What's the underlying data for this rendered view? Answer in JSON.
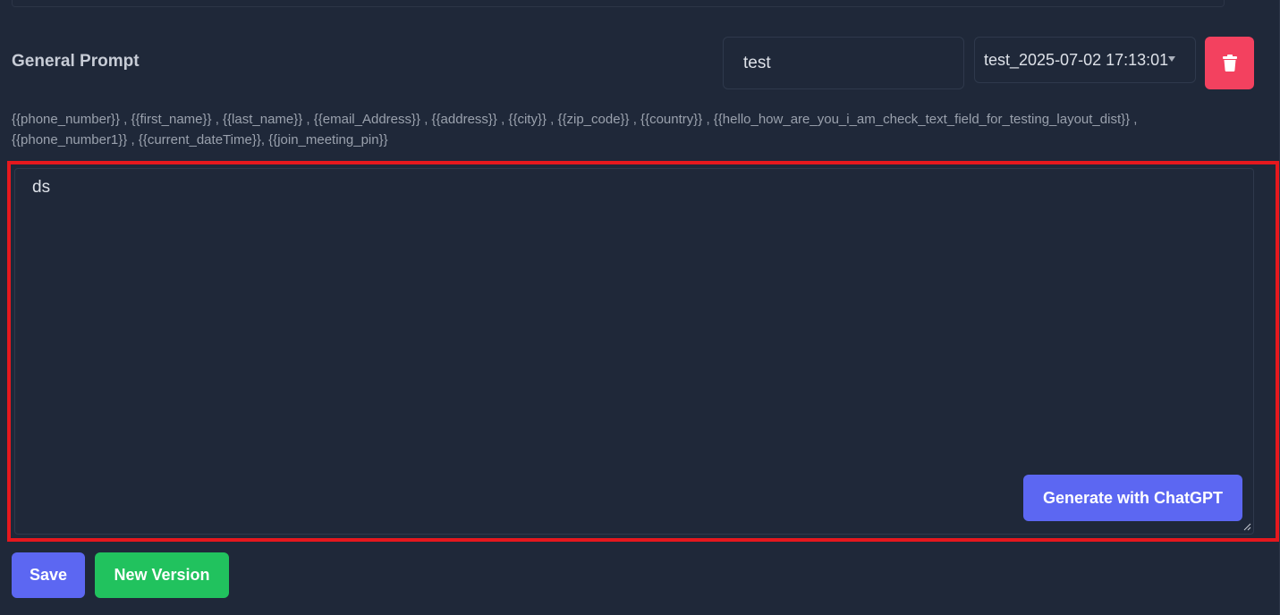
{
  "prompt": {
    "title": "General Prompt",
    "name_value": "test",
    "version_selected": "test_2025-07-02 17:13:01",
    "variables_line1": "{{phone_number}} , {{first_name}} , {{last_name}} , {{email_Address}} , {{address}} , {{city}} , {{zip_code}} , {{country}} , {{hello_how_are_you_i_am_check_text_field_for_testing_layout_dist}} ,",
    "variables_line2": "{{phone_number1}} , {{current_dateTime}}, {{join_meeting_pin}}",
    "body_text": "ds"
  },
  "buttons": {
    "generate_label": "Generate with ChatGPT",
    "save_label": "Save",
    "new_version_label": "New Version"
  },
  "icons": {
    "delete": "trash-icon",
    "dropdown": "caret-down-icon",
    "resize": "resize-grip-icon"
  },
  "colors": {
    "background": "#1f2839",
    "primary": "#5c67f2",
    "success": "#21c25e",
    "danger": "#f3415f",
    "highlight": "#e5181e"
  }
}
